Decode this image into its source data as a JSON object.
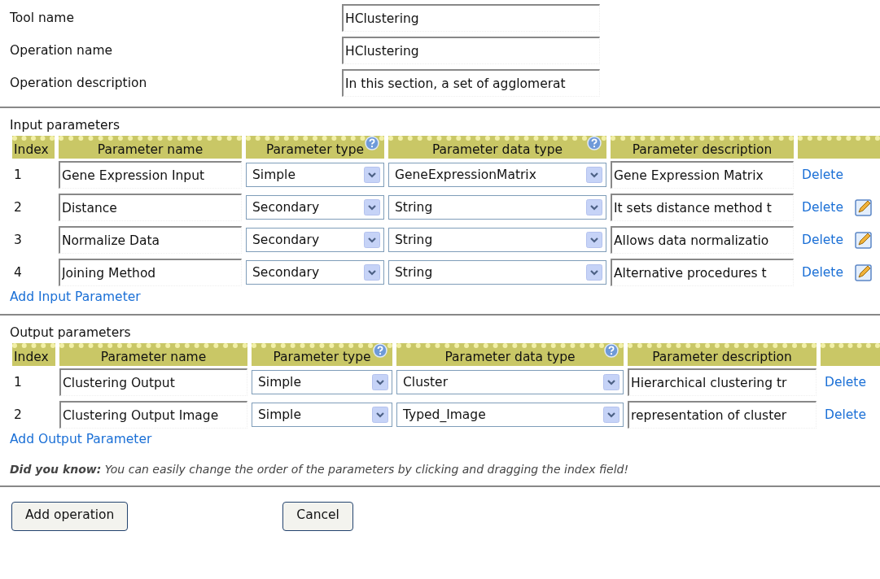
{
  "fields": [
    {
      "label": "Tool name",
      "value": "HClustering"
    },
    {
      "label": "Operation name",
      "value": "HClustering"
    },
    {
      "label": "Operation description",
      "value": "In this section, a set of agglomerat"
    }
  ],
  "tables": [
    {
      "title": "Input parameters",
      "columns": [
        {
          "label": "Index",
          "help": false
        },
        {
          "label": "Parameter name",
          "help": false
        },
        {
          "label": "Parameter type",
          "help": true
        },
        {
          "label": "Parameter data type",
          "help": true
        },
        {
          "label": "Parameter description",
          "help": false
        }
      ],
      "rows": [
        {
          "index": "1",
          "name": "Gene Expression Input",
          "type": "Simple",
          "data_type": "GeneExpressionMatrix",
          "description": "Gene Expression Matrix",
          "action": "Delete",
          "editable": false
        },
        {
          "index": "2",
          "name": "Distance",
          "type": "Secondary",
          "data_type": "String",
          "description": "It sets distance method t",
          "action": "Delete",
          "editable": true
        },
        {
          "index": "3",
          "name": "Normalize Data",
          "type": "Secondary",
          "data_type": "String",
          "description": "Allows data normalizatio",
          "action": "Delete",
          "editable": true
        },
        {
          "index": "4",
          "name": "Joining Method",
          "type": "Secondary",
          "data_type": "String",
          "description": "Alternative procedures t",
          "action": "Delete",
          "editable": true
        }
      ],
      "add_link": "Add Input Parameter"
    },
    {
      "title": "Output parameters",
      "columns": [
        {
          "label": "Index",
          "help": false
        },
        {
          "label": "Parameter name",
          "help": false
        },
        {
          "label": "Parameter type",
          "help": true
        },
        {
          "label": "Parameter data type",
          "help": true
        },
        {
          "label": "Parameter description",
          "help": false
        }
      ],
      "rows": [
        {
          "index": "1",
          "name": "Clustering Output",
          "type": "Simple",
          "data_type": "Cluster",
          "description": "Hierarchical clustering tr",
          "action": "Delete",
          "editable": false
        },
        {
          "index": "2",
          "name": "Clustering Output Image",
          "type": "Simple",
          "data_type": "Typed_Image",
          "description": "representation of cluster",
          "action": "Delete",
          "editable": false
        }
      ],
      "add_link": "Add Output Parameter"
    }
  ],
  "tip": "**Did you know:** You can easily change the order of the parameters by clicking and dragging the index field!",
  "buttons": [
    "Add operation",
    "Cancel"
  ]
}
